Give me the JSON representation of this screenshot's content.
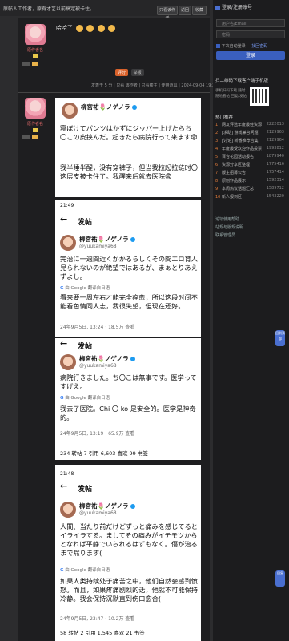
{
  "topbar": {
    "title": "原帖人工作者，原有才艺以前搞定被卡住。",
    "btn_collapse": "只看该作者",
    "btn_back": "返回",
    "btn_favorite": "收藏"
  },
  "post1": {
    "username": "原作者名",
    "reply_text": "哈哈了",
    "action_rating": "评分",
    "action_report": "举报",
    "meta": "发表于 5 分 | 只看 该作者 | 只看楼主 | 使用道具 | 2024-09-04 19:27 | 3楼"
  },
  "post2": {
    "username": "原作者名"
  },
  "sidebar": {
    "head": "登录/注册账号",
    "username_placeholder": "用户名/Email",
    "password_placeholder": "密码",
    "remember": "下次自动登录",
    "forgot": "找回密码",
    "login_btn": "登录",
    "qr_title": "扫二维码下载客户端手机版",
    "qr_desc": "手机扫码下载 随时随地看帖 回复/发帖",
    "hot_title": "热门推荐",
    "hot_items": [
      {
        "n": "1",
        "t": "网友评选年度最佳资源",
        "c": "2222013"
      },
      {
        "n": "2",
        "t": "[求助] 游戏兼容问题",
        "c": "2129963"
      },
      {
        "n": "3",
        "t": "[讨论] 新番推荐合集",
        "c": "2129964"
      },
      {
        "n": "4",
        "t": "年度最受欢迎作品投票",
        "c": "1993812"
      },
      {
        "n": "5",
        "t": "百合花园活动报名",
        "c": "1879940"
      },
      {
        "n": "6",
        "t": "资源分享区整理",
        "c": "1775416"
      },
      {
        "n": "7",
        "t": "版主招募公告",
        "c": "1757414"
      },
      {
        "n": "8",
        "t": "原创作品展示",
        "c": "1592314"
      },
      {
        "n": "9",
        "t": "本周热议话题汇总",
        "c": "1589712"
      },
      {
        "n": "10",
        "t": "新人报到区",
        "c": "1543220"
      }
    ],
    "links": [
      "论坛使用帮助",
      "站规与版规说明",
      "联系管理员"
    ]
  },
  "float_buttons": [
    "回到顶部",
    "回复"
  ],
  "tweets": [
    {
      "name": "柳宮祐🌷ノゲノラ",
      "handle": "",
      "text_jp": "寝ぼけてパンツはかずにジッパー上げたらち〇この皮挟んだ。起きたら病院行って来ます😨",
      "text_cn": "我半睡半醒，没有穿裤子，但当我拉起拉链时〇这层皮被卡住了。我醒来后就去医院😨",
      "google": "",
      "foot": "",
      "stats": ""
    },
    {
      "status_time": "21:49",
      "page_title": "发帖",
      "name": "柳宮祐🌷ノゲノラ",
      "handle": "@yuukamiya68",
      "text_jp": "完治に一週間近くかかるらしくその間エロ育人見られないのが絶望ではあるが、まぁとりあえずよし。",
      "google": "由 Google 翻译自日语",
      "text_cn": "看来要一周左右才能完全痊愈，所以这段时间不能看色情同人志，我很失望，但现在还好。",
      "foot": "24年9月5日, 13:24 · 18.5万 查看",
      "stats": ""
    },
    {
      "page_title": "发帖",
      "name": "柳宮祐🌷ノゲノラ",
      "handle": "@yuukamiya68",
      "text_jp": "病院行きました。ち〇こは無事です。医学ってすげえ。",
      "google": "由 Google 翻译自日语",
      "text_cn": "我去了医院。Chi 〇 ko 是安全的。医学是神奇的。",
      "foot": "24年9月5日, 13:19 · 65.9万 查看",
      "stats": "234 转帖   7 引用   6,603 喜欢   99 书签"
    },
    {
      "status_time": "21:48",
      "page_title": "发帖",
      "name": "柳宮祐🌷ノゲノラ",
      "handle": "@yuukamiya68",
      "text_jp": "人間、当たり前だけどずっと痛みを感じてるとイライラする。ましてその痛みがイチモツからとなれば平静でいられるはずもなく。傷が治るまで黙ります(",
      "google": "由 Google 翻译自日语",
      "text_cn": "如果人类持续处于痛苦之中，他们自然会感到愤怒。而且，如果疼痛剧烈的话，他就不可能保持冷静。我会保持沉默直到伤口愈合(",
      "foot": "24年9月5日, 23:47 · 10.2万 查看",
      "stats": "58 转帖   2 引用   1,545 喜欢   21 书签"
    }
  ]
}
